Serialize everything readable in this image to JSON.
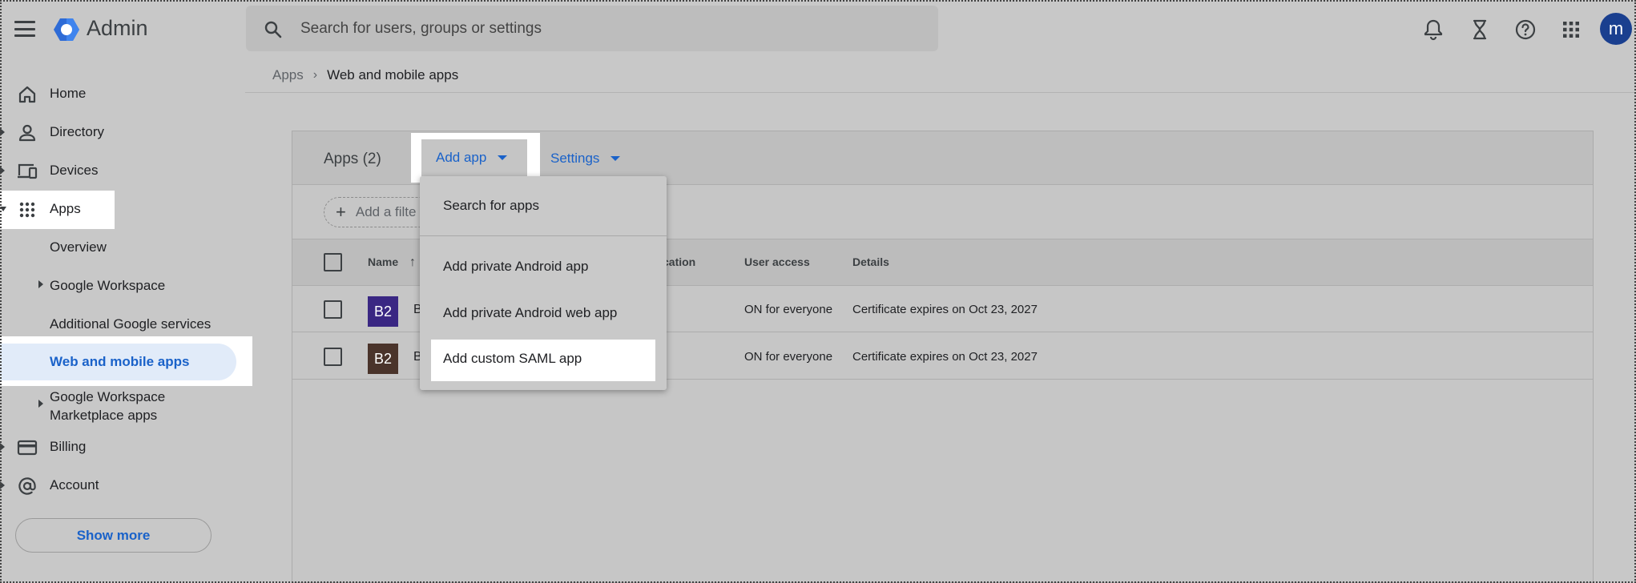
{
  "topbar": {
    "brand": "Admin",
    "search_placeholder": "Search for users, groups or settings",
    "avatar_initial": "m",
    "icons": [
      "menu-icon",
      "google-cloud-logo",
      "search-icon",
      "bell-icon",
      "hourglass-icon",
      "help-icon",
      "apps-grid-icon"
    ]
  },
  "sidebar": {
    "items": [
      {
        "label": "Home",
        "icon": "home-icon"
      },
      {
        "label": "Directory",
        "icon": "person-icon"
      },
      {
        "label": "Devices",
        "icon": "devices-icon"
      },
      {
        "label": "Apps",
        "icon": "apps-grid-icon"
      }
    ],
    "apps_children": {
      "overview": "Overview",
      "google_workspace": "Google Workspace",
      "additional_services": "Additional Google services",
      "web_mobile": "Web and mobile apps",
      "marketplace_line1": "Google Workspace",
      "marketplace_line2": "Marketplace apps"
    },
    "billing": "Billing",
    "account": "Account",
    "show_more": "Show more"
  },
  "breadcrumb": {
    "parent": "Apps",
    "separator": "›",
    "current": "Web and mobile apps"
  },
  "card": {
    "title": "Apps (2)",
    "add_app": "Add app",
    "settings": "Settings",
    "filter": "Add a filte",
    "columns": {
      "name": "Name",
      "auth": "cation",
      "user_access": "User access",
      "details": "Details"
    },
    "rows": [
      {
        "icon_text": "B2",
        "icon_color": "#3a2783",
        "name": "B",
        "user_access": "ON for everyone",
        "details": "Certificate expires on Oct 23, 2027"
      },
      {
        "icon_text": "B2",
        "icon_color": "#4a342b",
        "name": "B",
        "user_access": "ON for everyone",
        "details": "Certificate expires on Oct 23, 2027"
      }
    ]
  },
  "dropdown": {
    "items": [
      "Search for apps",
      "Add private Android app",
      "Add private Android web app",
      "Add custom SAML app"
    ]
  },
  "colors": {
    "accent": "#1a62c9",
    "avatar": "#1a3f8f",
    "highlight": "#ffffff"
  }
}
